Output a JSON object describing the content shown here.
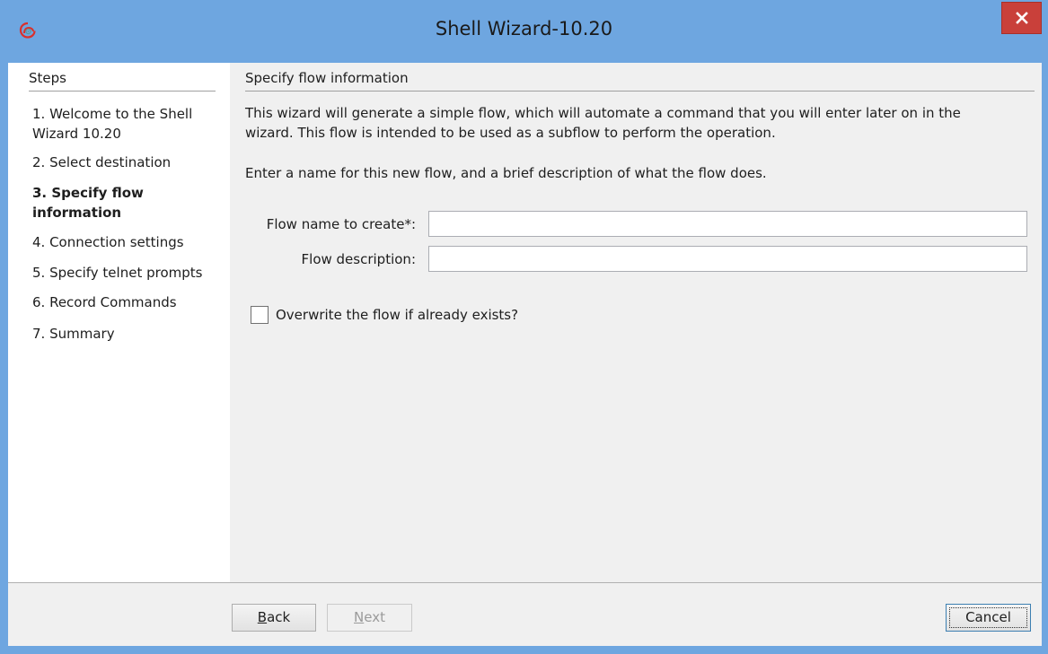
{
  "window": {
    "title": "Shell Wizard-10.20",
    "icon": "app-logo-icon",
    "close_icon": "close-icon",
    "accent": "#6ea6e0",
    "close_color": "#c9403a"
  },
  "steps": {
    "title": "Steps",
    "items": [
      {
        "label": "1. Welcome to the Shell\nWizard 10.20",
        "active": false
      },
      {
        "label": "2. Select destination",
        "active": false
      },
      {
        "label": "3. Specify flow\ninformation",
        "active": true
      },
      {
        "label": "4. Connection settings",
        "active": false
      },
      {
        "label": "5. Specify telnet prompts",
        "active": false
      },
      {
        "label": "6. Record Commands",
        "active": false
      },
      {
        "label": "7. Summary",
        "active": false
      }
    ]
  },
  "content": {
    "title": "Specify flow information",
    "intro_line1": "This wizard will generate a simple flow, which will automate a command that you will enter later on in the",
    "intro_line2": "wizard. This flow is intended to be used as a subflow to perform the operation.",
    "instruction": "Enter a name for this new flow, and a brief description of what the flow does.",
    "flow_name": {
      "label": "Flow name to create*:",
      "value": ""
    },
    "flow_description": {
      "label": "Flow description:",
      "value": ""
    },
    "overwrite": {
      "label": "Overwrite the flow if already exists?",
      "checked": false
    }
  },
  "footer": {
    "back": {
      "mnemonic": "B",
      "rest": "ack"
    },
    "next": {
      "mnemonic": "N",
      "rest": "ext"
    },
    "cancel": "Cancel"
  }
}
